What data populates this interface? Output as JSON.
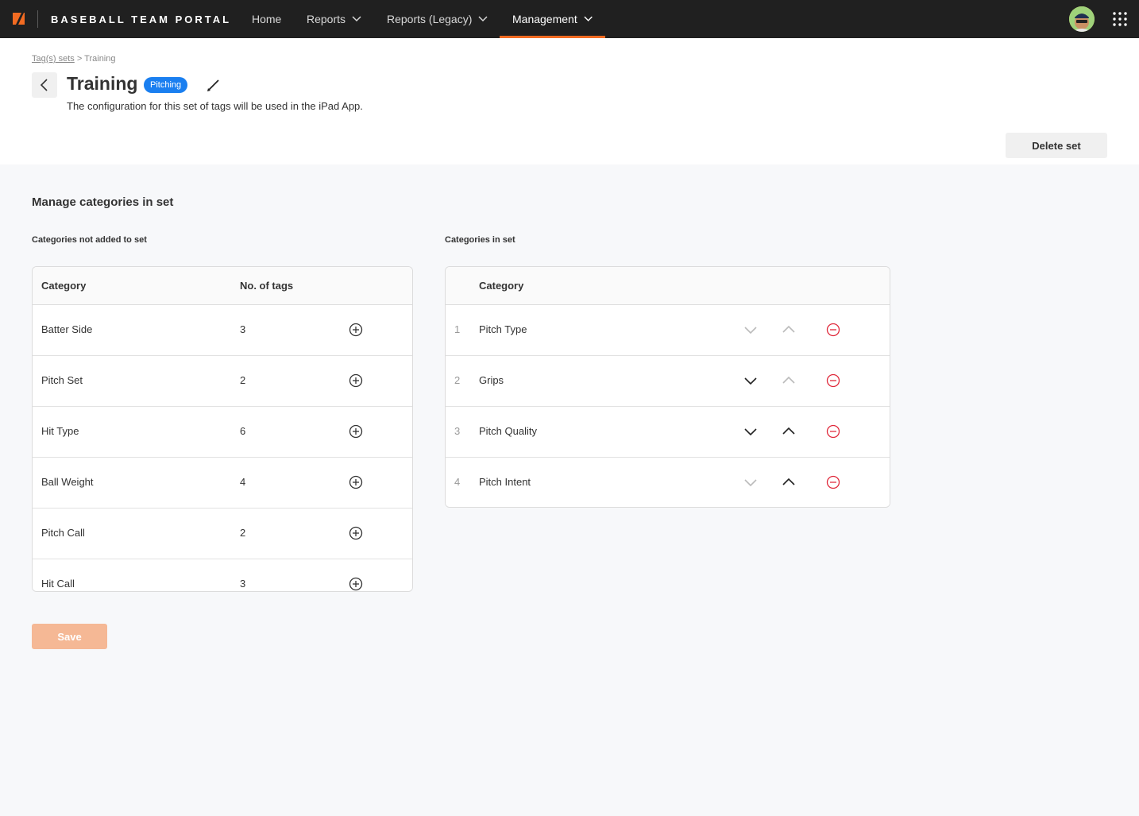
{
  "nav": {
    "brand": "BASEBALL TEAM PORTAL",
    "items": [
      {
        "label": "Home",
        "has_menu": false,
        "active": false
      },
      {
        "label": "Reports",
        "has_menu": true,
        "active": false
      },
      {
        "label": "Reports (Legacy)",
        "has_menu": true,
        "active": false
      },
      {
        "label": "Management",
        "has_menu": true,
        "active": true
      }
    ],
    "accent_color": "#f26b22"
  },
  "header": {
    "breadcrumb_link": "Tag(s) sets",
    "breadcrumb_sep": ">",
    "breadcrumb_current": "Training",
    "title": "Training",
    "badge": "Pitching",
    "subtitle": "The configuration for this set of tags will be used in the iPad App.",
    "delete_label": "Delete set"
  },
  "main": {
    "section_title": "Manage categories in set",
    "available": {
      "title": "Categories not added to set",
      "columns": [
        "Category",
        "No. of tags"
      ],
      "rows": [
        {
          "category": "Batter Side",
          "tags": "3"
        },
        {
          "category": "Pitch Set",
          "tags": "2"
        },
        {
          "category": "Hit Type",
          "tags": "6"
        },
        {
          "category": "Ball Weight",
          "tags": "4"
        },
        {
          "category": "Pitch Call",
          "tags": "2"
        },
        {
          "category": "Hit Call",
          "tags": "3"
        }
      ]
    },
    "in_set": {
      "title": "Categories in set",
      "columns": [
        "Category"
      ],
      "rows": [
        {
          "index": "1",
          "category": "Pitch Type",
          "down_enabled": false,
          "up_enabled": false
        },
        {
          "index": "2",
          "category": "Grips",
          "down_enabled": true,
          "up_enabled": false
        },
        {
          "index": "3",
          "category": "Pitch Quality",
          "down_enabled": true,
          "up_enabled": true
        },
        {
          "index": "4",
          "category": "Pitch Intent",
          "down_enabled": false,
          "up_enabled": true
        }
      ]
    },
    "save_label": "Save"
  }
}
